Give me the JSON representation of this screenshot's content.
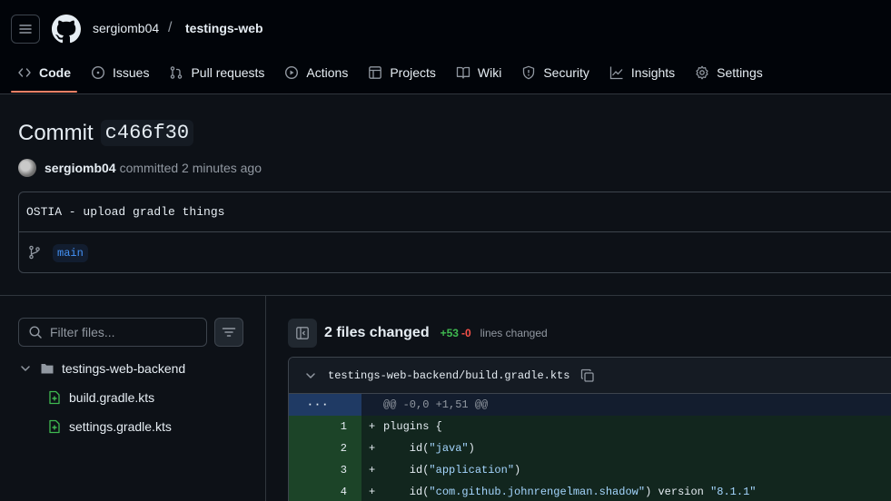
{
  "breadcrumb": {
    "owner": "sergiomb04",
    "separator": "/",
    "repo": "testings-web"
  },
  "tabs": [
    {
      "label": "Code",
      "icon": "code-icon",
      "active": true
    },
    {
      "label": "Issues",
      "icon": "issue-icon"
    },
    {
      "label": "Pull requests",
      "icon": "pull-request-icon"
    },
    {
      "label": "Actions",
      "icon": "play-icon"
    },
    {
      "label": "Projects",
      "icon": "table-icon"
    },
    {
      "label": "Wiki",
      "icon": "book-icon"
    },
    {
      "label": "Security",
      "icon": "shield-icon"
    },
    {
      "label": "Insights",
      "icon": "graph-icon"
    },
    {
      "label": "Settings",
      "icon": "gear-icon"
    }
  ],
  "commit": {
    "title_prefix": "Commit",
    "sha": "c466f30",
    "author": "sergiomb04",
    "committed_text": "committed 2 minutes ago",
    "message": "OSTIA - upload gradle things",
    "branch": "main"
  },
  "file_tree": {
    "filter_placeholder": "Filter files...",
    "folder": "testings-web-backend",
    "files": [
      "build.gradle.kts",
      "settings.gradle.kts"
    ]
  },
  "summary": {
    "files_changed": "2 files changed",
    "additions": "+53",
    "deletions": "-0",
    "lines_changed": "lines changed"
  },
  "diff": {
    "path": "testings-web-backend/build.gradle.kts",
    "hunk_marker": "···",
    "hunk_header": "@@ -0,0 +1,51 @@",
    "lines": [
      {
        "num": "1",
        "sign": "+",
        "text": "plugins {"
      },
      {
        "num": "2",
        "sign": "+",
        "text": "    id(\"java\")"
      },
      {
        "num": "3",
        "sign": "+",
        "text": "    id(\"application\")"
      },
      {
        "num": "4",
        "sign": "+",
        "text": "    id(\"com.github.johnrengelman.shadow\") version \"8.1.1\""
      }
    ]
  },
  "colors": {
    "accent_tab": "#f78166",
    "added_bg": "#12261e",
    "added_gutter": "#1c4428",
    "hunk_gutter": "#1f3a64",
    "link": "#4493f8"
  }
}
